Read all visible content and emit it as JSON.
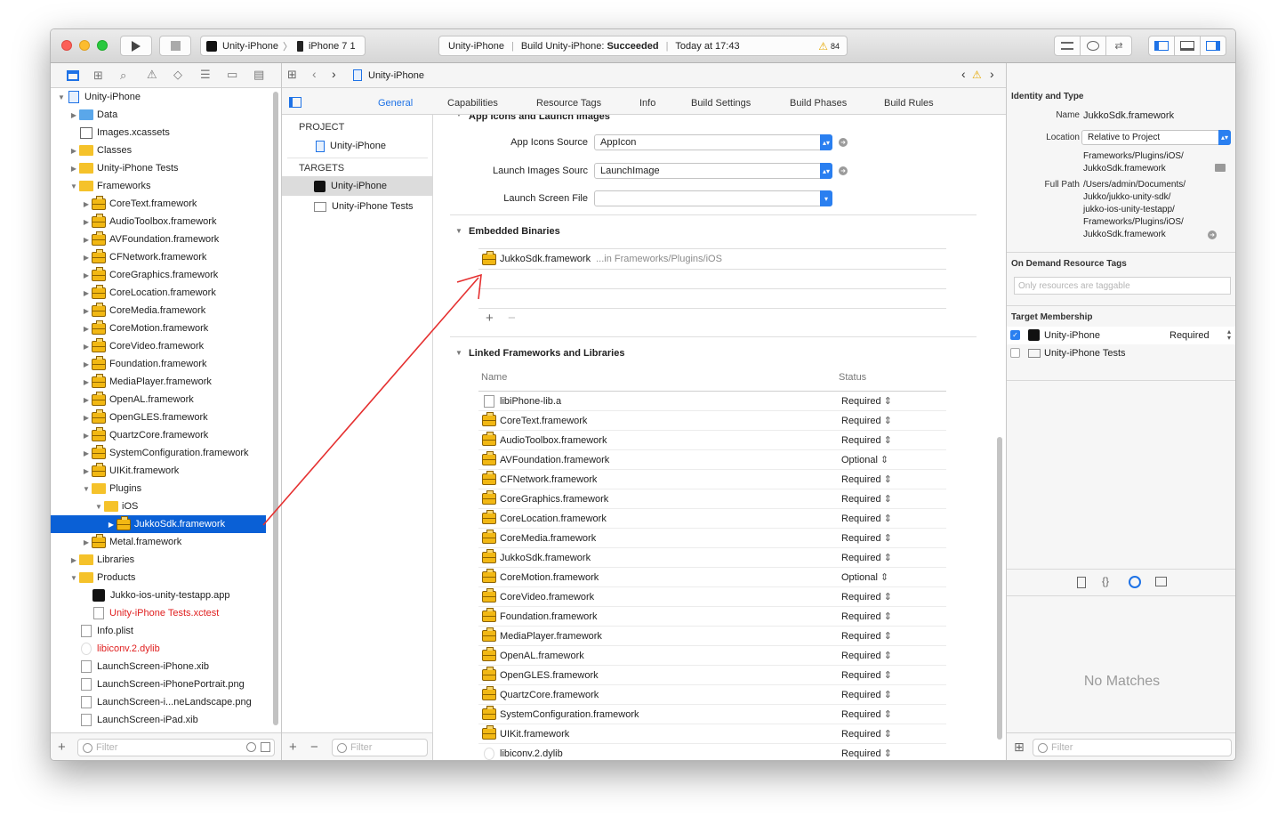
{
  "titlebar": {
    "scheme": "Unity-iPhone",
    "device": "iPhone 7 1",
    "status_project": "Unity-iPhone",
    "status_text": "Build Unity-iPhone:",
    "status_result": "Succeeded",
    "status_time": "Today at 17:43",
    "warning_count": "84"
  },
  "jumpbar": {
    "file": "Unity-iPhone"
  },
  "navigator": {
    "filter_placeholder": "Filter",
    "items": [
      {
        "label": "Unity-iPhone",
        "indent": 0,
        "disc": "▼",
        "icon": "project"
      },
      {
        "label": "Data",
        "indent": 1,
        "disc": "▶",
        "icon": "folder-blue"
      },
      {
        "label": "Images.xcassets",
        "indent": 1,
        "disc": "",
        "icon": "assets"
      },
      {
        "label": "Classes",
        "indent": 1,
        "disc": "▶",
        "icon": "folder"
      },
      {
        "label": "Unity-iPhone Tests",
        "indent": 1,
        "disc": "▶",
        "icon": "folder"
      },
      {
        "label": "Frameworks",
        "indent": 1,
        "disc": "▼",
        "icon": "folder"
      },
      {
        "label": "CoreText.framework",
        "indent": 2,
        "disc": "▶",
        "icon": "framework"
      },
      {
        "label": "AudioToolbox.framework",
        "indent": 2,
        "disc": "▶",
        "icon": "framework"
      },
      {
        "label": "AVFoundation.framework",
        "indent": 2,
        "disc": "▶",
        "icon": "framework"
      },
      {
        "label": "CFNetwork.framework",
        "indent": 2,
        "disc": "▶",
        "icon": "framework"
      },
      {
        "label": "CoreGraphics.framework",
        "indent": 2,
        "disc": "▶",
        "icon": "framework"
      },
      {
        "label": "CoreLocation.framework",
        "indent": 2,
        "disc": "▶",
        "icon": "framework"
      },
      {
        "label": "CoreMedia.framework",
        "indent": 2,
        "disc": "▶",
        "icon": "framework"
      },
      {
        "label": "CoreMotion.framework",
        "indent": 2,
        "disc": "▶",
        "icon": "framework"
      },
      {
        "label": "CoreVideo.framework",
        "indent": 2,
        "disc": "▶",
        "icon": "framework"
      },
      {
        "label": "Foundation.framework",
        "indent": 2,
        "disc": "▶",
        "icon": "framework"
      },
      {
        "label": "MediaPlayer.framework",
        "indent": 2,
        "disc": "▶",
        "icon": "framework"
      },
      {
        "label": "OpenAL.framework",
        "indent": 2,
        "disc": "▶",
        "icon": "framework"
      },
      {
        "label": "OpenGLES.framework",
        "indent": 2,
        "disc": "▶",
        "icon": "framework"
      },
      {
        "label": "QuartzCore.framework",
        "indent": 2,
        "disc": "▶",
        "icon": "framework"
      },
      {
        "label": "SystemConfiguration.framework",
        "indent": 2,
        "disc": "▶",
        "icon": "framework"
      },
      {
        "label": "UIKit.framework",
        "indent": 2,
        "disc": "▶",
        "icon": "framework"
      },
      {
        "label": "Plugins",
        "indent": 2,
        "disc": "▼",
        "icon": "folder"
      },
      {
        "label": "iOS",
        "indent": 3,
        "disc": "▼",
        "icon": "folder"
      },
      {
        "label": "JukkoSdk.framework",
        "indent": 4,
        "disc": "▶",
        "icon": "framework",
        "selected": true
      },
      {
        "label": "Metal.framework",
        "indent": 2,
        "disc": "▶",
        "icon": "framework"
      },
      {
        "label": "Libraries",
        "indent": 1,
        "disc": "▶",
        "icon": "folder"
      },
      {
        "label": "Products",
        "indent": 1,
        "disc": "▼",
        "icon": "folder"
      },
      {
        "label": "Jukko-ios-unity-testapp.app",
        "indent": 2,
        "disc": "",
        "icon": "app"
      },
      {
        "label": "Unity-iPhone Tests.xctest",
        "indent": 2,
        "disc": "",
        "icon": "doc",
        "red": true
      },
      {
        "label": "Info.plist",
        "indent": 1,
        "disc": "",
        "icon": "doc"
      },
      {
        "label": "libiconv.2.dylib",
        "indent": 1,
        "disc": "",
        "icon": "dylib",
        "red": true
      },
      {
        "label": "LaunchScreen-iPhone.xib",
        "indent": 1,
        "disc": "",
        "icon": "doc"
      },
      {
        "label": "LaunchScreen-iPhonePortrait.png",
        "indent": 1,
        "disc": "",
        "icon": "doc"
      },
      {
        "label": "LaunchScreen-i...neLandscape.png",
        "indent": 1,
        "disc": "",
        "icon": "doc"
      },
      {
        "label": "LaunchScreen-iPad.xib",
        "indent": 1,
        "disc": "",
        "icon": "doc"
      }
    ]
  },
  "tabs": [
    "General",
    "Capabilities",
    "Resource Tags",
    "Info",
    "Build Settings",
    "Build Phases",
    "Build Rules"
  ],
  "targets_list": {
    "project_header": "PROJECT",
    "project_item": "Unity-iPhone",
    "targets_header": "TARGETS",
    "targets": [
      "Unity-iPhone",
      "Unity-iPhone Tests"
    ],
    "filter_placeholder": "Filter"
  },
  "general": {
    "section_icons": "App Icons and Launch Images",
    "app_icons_label": "App Icons Source",
    "app_icons_value": "AppIcon",
    "launch_images_label": "Launch Images Sourc",
    "launch_images_value": "LaunchImage",
    "launch_screen_label": "Launch Screen File",
    "launch_screen_value": "",
    "embedded_title": "Embedded Binaries",
    "embedded_item": "JukkoSdk.framework",
    "embedded_path": "...in Frameworks/Plugins/iOS",
    "linked_title": "Linked Frameworks and Libraries",
    "col_name": "Name",
    "col_status": "Status",
    "linked": [
      {
        "name": "libiPhone-lib.a",
        "status": "Required",
        "icon": "doc"
      },
      {
        "name": "CoreText.framework",
        "status": "Required",
        "icon": "framework"
      },
      {
        "name": "AudioToolbox.framework",
        "status": "Required",
        "icon": "framework"
      },
      {
        "name": "AVFoundation.framework",
        "status": "Optional",
        "icon": "framework"
      },
      {
        "name": "CFNetwork.framework",
        "status": "Required",
        "icon": "framework"
      },
      {
        "name": "CoreGraphics.framework",
        "status": "Required",
        "icon": "framework"
      },
      {
        "name": "CoreLocation.framework",
        "status": "Required",
        "icon": "framework"
      },
      {
        "name": "CoreMedia.framework",
        "status": "Required",
        "icon": "framework"
      },
      {
        "name": "JukkoSdk.framework",
        "status": "Required",
        "icon": "framework"
      },
      {
        "name": "CoreMotion.framework",
        "status": "Optional",
        "icon": "framework"
      },
      {
        "name": "CoreVideo.framework",
        "status": "Required",
        "icon": "framework"
      },
      {
        "name": "Foundation.framework",
        "status": "Required",
        "icon": "framework"
      },
      {
        "name": "MediaPlayer.framework",
        "status": "Required",
        "icon": "framework"
      },
      {
        "name": "OpenAL.framework",
        "status": "Required",
        "icon": "framework"
      },
      {
        "name": "OpenGLES.framework",
        "status": "Required",
        "icon": "framework"
      },
      {
        "name": "QuartzCore.framework",
        "status": "Required",
        "icon": "framework"
      },
      {
        "name": "SystemConfiguration.framework",
        "status": "Required",
        "icon": "framework"
      },
      {
        "name": "UIKit.framework",
        "status": "Required",
        "icon": "framework"
      },
      {
        "name": "libiconv.2.dylib",
        "status": "Required",
        "icon": "dylib"
      }
    ]
  },
  "inspector": {
    "identity_title": "Identity and Type",
    "name_label": "Name",
    "name_value": "JukkoSdk.framework",
    "location_label": "Location",
    "location_value": "Relative to Project",
    "location_path_1": "Frameworks/Plugins/iOS/",
    "location_path_2": "JukkoSdk.framework",
    "fullpath_label": "Full Path",
    "fullpath_lines": [
      "/Users/admin/Documents/",
      "Jukko/jukko-unity-sdk/",
      "jukko-ios-unity-testapp/",
      "Frameworks/Plugins/iOS/",
      "JukkoSdk.framework"
    ],
    "odr_title": "On Demand Resource Tags",
    "odr_placeholder": "Only resources are taggable",
    "membership_title": "Target Membership",
    "membership": [
      {
        "name": "Unity-iPhone",
        "status": "Required",
        "checked": true
      },
      {
        "name": "Unity-iPhone Tests",
        "status": "",
        "checked": false
      }
    ],
    "no_matches": "No Matches",
    "filter_placeholder": "Filter"
  },
  "colors": {
    "accent": "#0a60d6",
    "folder": "#f5c22a",
    "red_arrow": "#e53030",
    "missing_file": "#e02020"
  }
}
